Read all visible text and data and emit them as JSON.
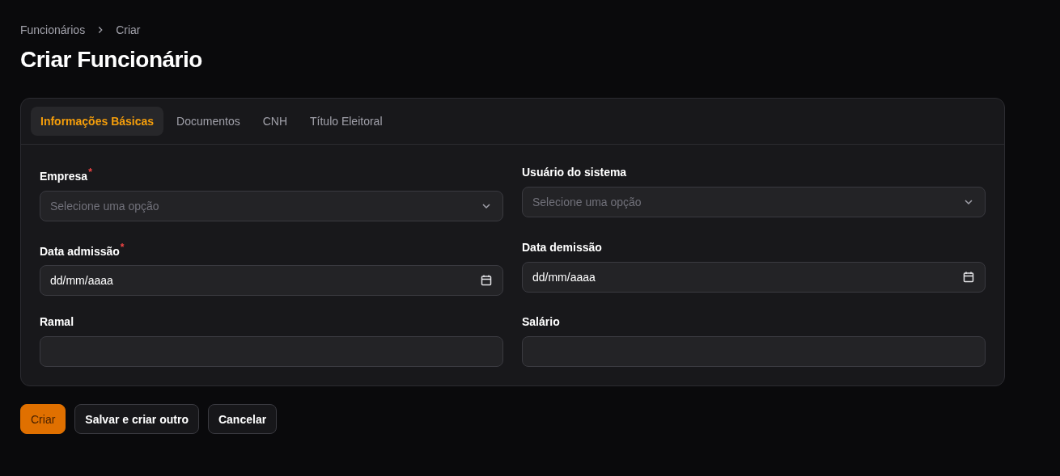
{
  "breadcrumb": [
    "Funcionários",
    "Criar"
  ],
  "title": "Criar Funcionário",
  "tabs": [
    {
      "label": "Informações Básicas",
      "selected": true
    },
    {
      "label": "Documentos",
      "selected": false
    },
    {
      "label": "CNH",
      "selected": false
    },
    {
      "label": "Título Eleitoral",
      "selected": false
    }
  ],
  "fields": [
    {
      "kind": "select",
      "label": "Empresa",
      "required_mark": "*",
      "placeholder": "Selecione uma opção"
    },
    {
      "kind": "select",
      "label": "Usuário do sistema",
      "placeholder": "Selecione uma opção"
    },
    {
      "kind": "date",
      "label": "Data admissão",
      "required_mark": "*",
      "value": "dd/mm/aaaa"
    },
    {
      "kind": "date",
      "label": "Data demissão",
      "value": "dd/mm/aaaa"
    },
    {
      "kind": "text",
      "label": "Ramal"
    },
    {
      "kind": "text",
      "label": "Salário"
    }
  ],
  "buttons": [
    {
      "label": "Criar",
      "kind": "primary"
    },
    {
      "label": "Salvar e criar outro",
      "kind": "secondary"
    },
    {
      "label": "Cancelar",
      "kind": "secondary"
    }
  ]
}
